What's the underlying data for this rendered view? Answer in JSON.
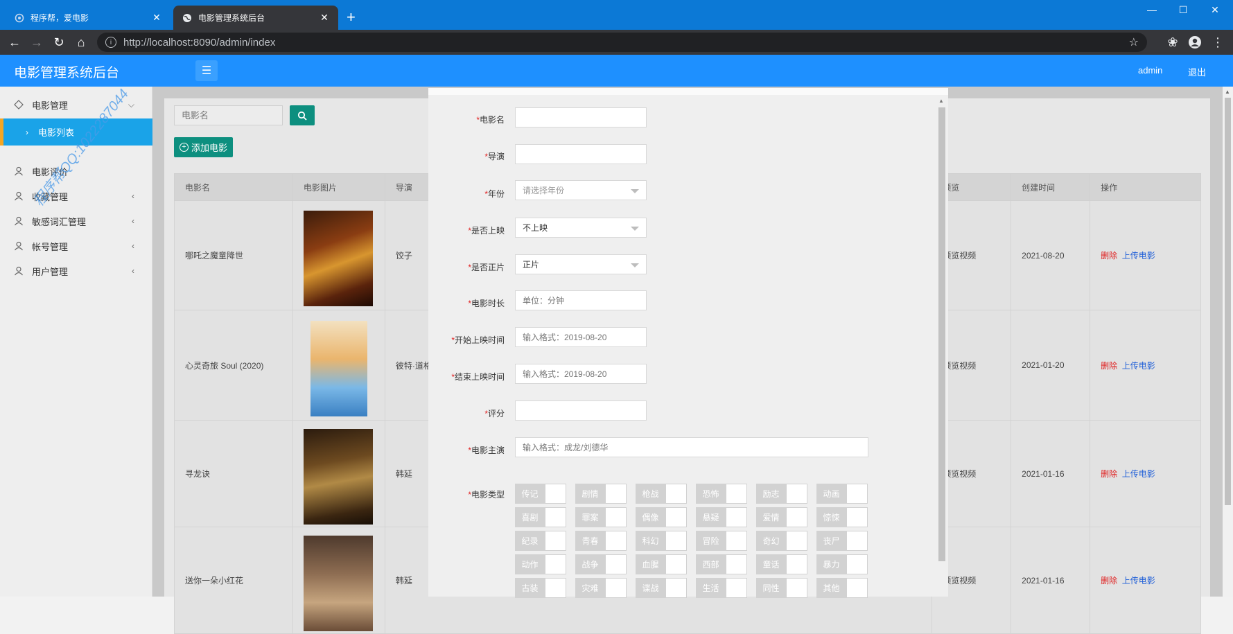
{
  "browser": {
    "tabs": [
      {
        "title": "程序帮，爱电影",
        "close": "✕"
      },
      {
        "title": "电影管理系统后台",
        "close": "✕"
      }
    ],
    "new_tab": "+",
    "url_host": "http://localhost",
    "url_rest": ":8090/admin/index",
    "window_controls": {
      "minimize": "—",
      "maximize": "☐",
      "close": "✕"
    }
  },
  "header": {
    "brand": "电影管理系统后台",
    "user": "admin",
    "logout": "退出"
  },
  "sidebar": {
    "items": [
      {
        "label": "电影管理",
        "icon": "movie-icon",
        "arrow": "⌵"
      },
      {
        "label": "电影评价",
        "icon": "user-icon",
        "arrow": ""
      },
      {
        "label": "收藏管理",
        "icon": "user-icon",
        "arrow": "‹"
      },
      {
        "label": "敏感词汇管理",
        "icon": "user-icon",
        "arrow": "‹"
      },
      {
        "label": "帐号管理",
        "icon": "user-icon",
        "arrow": "‹"
      },
      {
        "label": "用户管理",
        "icon": "user-icon",
        "arrow": "‹"
      }
    ],
    "sub_item": "电影列表",
    "watermark": "程序帮QQ:1022287044"
  },
  "toolbar": {
    "search_placeholder": "电影名",
    "add_label": "添加电影"
  },
  "table": {
    "headers": [
      "电影名",
      "电影图片",
      "导演",
      "预览",
      "创建时间",
      "操作"
    ],
    "rows": [
      {
        "name": "哪吒之魔童降世",
        "director": "饺子",
        "preview": "预览视频",
        "created": "2021-08-20",
        "delete": "删除",
        "upload": "上传电影"
      },
      {
        "name": "心灵奇旅 Soul (2020)",
        "director": "彼特·道格",
        "preview": "预览视频",
        "created": "2021-01-20",
        "delete": "删除",
        "upload": "上传电影"
      },
      {
        "name": "寻龙诀",
        "director": "韩延",
        "preview": "预览视频",
        "created": "2021-01-16",
        "delete": "删除",
        "upload": "上传电影"
      },
      {
        "name": "送你一朵小红花",
        "director": "韩延",
        "preview": "预览视频",
        "created": "2021-01-16",
        "delete": "删除",
        "upload": "上传电影"
      }
    ]
  },
  "modal": {
    "fields": [
      {
        "label": "电影名",
        "value": "",
        "placeholder": ""
      },
      {
        "label": "导演",
        "value": "",
        "placeholder": ""
      },
      {
        "label": "年份",
        "value": "",
        "placeholder": "请选择年份"
      },
      {
        "label": "是否上映",
        "value": "不上映",
        "placeholder": ""
      },
      {
        "label": "是否正片",
        "value": "正片",
        "placeholder": ""
      },
      {
        "label": "电影时长",
        "value": "",
        "placeholder": "单位：分钟"
      },
      {
        "label": "开始上映时间",
        "value": "",
        "placeholder": "输入格式：2019-08-20"
      },
      {
        "label": "结束上映时间",
        "value": "",
        "placeholder": "输入格式：2019-08-20"
      },
      {
        "label": "评分",
        "value": "",
        "placeholder": ""
      },
      {
        "label": "电影主演",
        "value": "",
        "placeholder": "输入格式：成龙/刘德华"
      }
    ],
    "types_label": "电影类型",
    "types": [
      [
        "传记",
        "剧情",
        "枪战",
        "恐怖",
        "励志",
        "动画"
      ],
      [
        "喜剧",
        "罪案",
        "偶像",
        "悬疑",
        "爱情",
        "惊悚"
      ],
      [
        "纪录",
        "青春",
        "科幻",
        "冒险",
        "奇幻",
        "丧尸"
      ],
      [
        "动作",
        "战争",
        "血腥",
        "西部",
        "童话",
        "暴力"
      ],
      [
        "古装",
        "灾难",
        "谍战",
        "生活",
        "同性",
        "其他"
      ]
    ]
  },
  "colors": {
    "header_bg": "#1e90ff",
    "sidebar_active": "#1aa3e8",
    "primary_button": "#0d8f7f",
    "preview_green": "#2b9b2b",
    "delete_red": "#e02020",
    "upload_blue": "#1e5ed8"
  }
}
